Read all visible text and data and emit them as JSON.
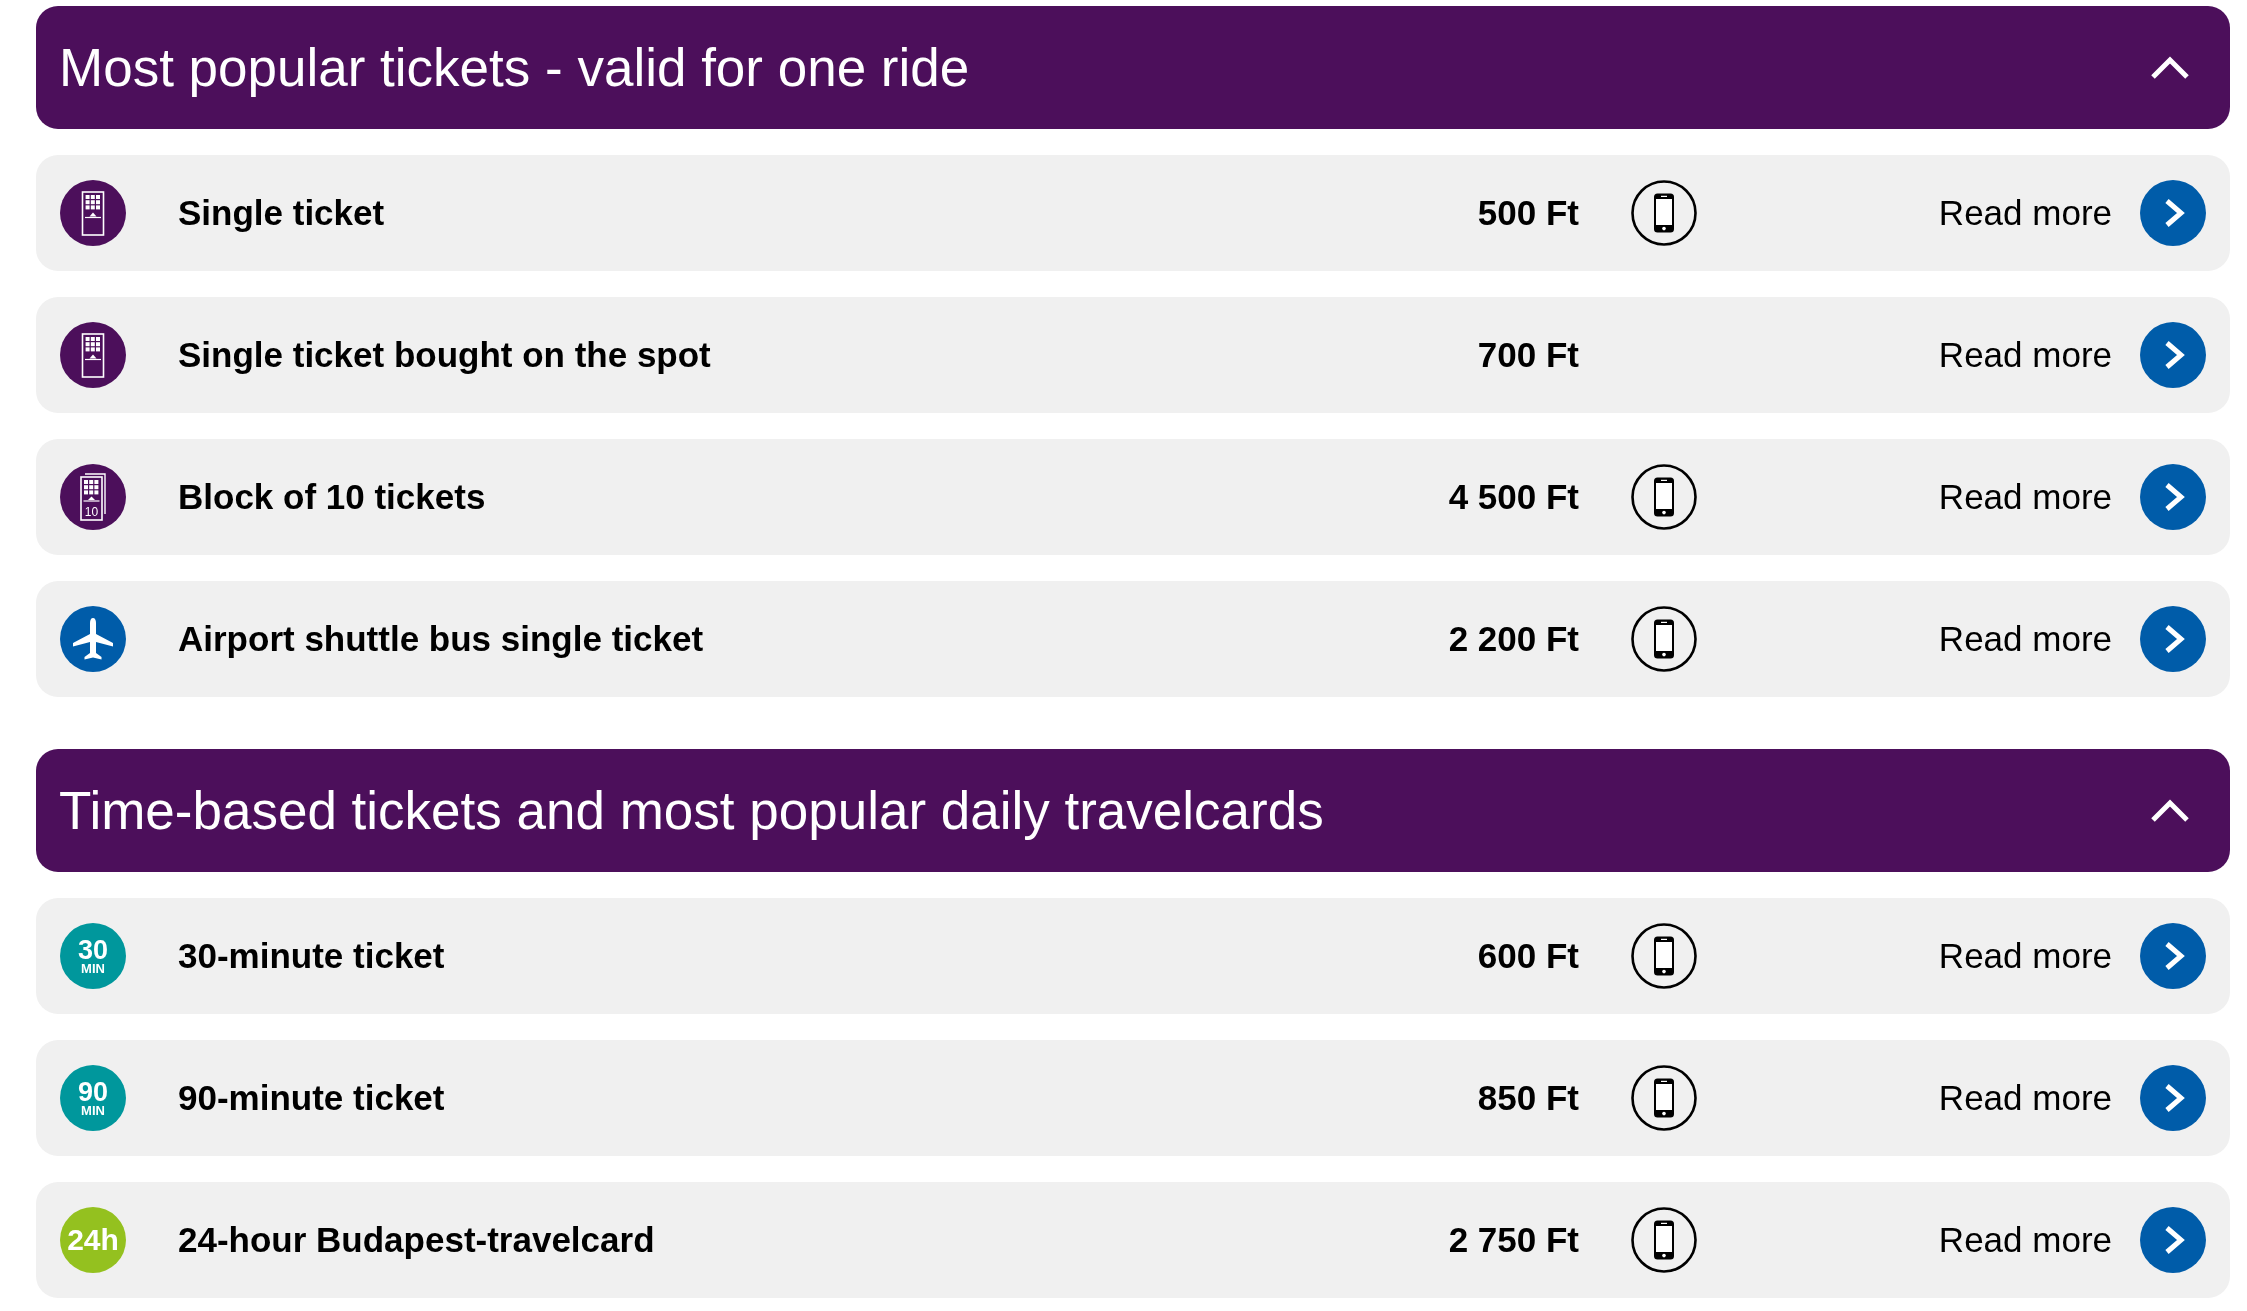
{
  "sections": [
    {
      "title": "Most popular tickets - valid for one ride",
      "expanded": true,
      "rows": [
        {
          "name": "Single ticket",
          "price": "500 Ft",
          "mobile": true,
          "link": "Read more",
          "icon": {
            "kind": "ticket",
            "color": "#4c0f5b"
          }
        },
        {
          "name": "Single ticket bought on the spot",
          "price": "700 Ft",
          "mobile": false,
          "link": "Read more",
          "icon": {
            "kind": "ticket",
            "color": "#4c0f5b"
          }
        },
        {
          "name": "Block of 10 tickets",
          "price": "4 500 Ft",
          "mobile": true,
          "link": "Read more",
          "icon": {
            "kind": "ticket-block",
            "color": "#4c0f5b",
            "text": "10"
          }
        },
        {
          "name": "Airport shuttle bus single ticket",
          "price": "2 200 Ft",
          "mobile": true,
          "link": "Read more",
          "icon": {
            "kind": "plane",
            "color": "#005ca9"
          }
        }
      ]
    },
    {
      "title": "Time-based tickets and most popular daily travelcards",
      "expanded": true,
      "rows": [
        {
          "name": "30-minute ticket",
          "price": "600 Ft",
          "mobile": true,
          "link": "Read more",
          "icon": {
            "kind": "badge",
            "color": "#00979c",
            "lines": [
              "30",
              "MIN"
            ]
          }
        },
        {
          "name": "90-minute ticket",
          "price": "850 Ft",
          "mobile": true,
          "link": "Read more",
          "icon": {
            "kind": "badge",
            "color": "#00979c",
            "lines": [
              "90",
              "MIN"
            ]
          }
        },
        {
          "name": "24-hour Budapest-travelcard",
          "price": "2 750 Ft",
          "mobile": true,
          "link": "Read more",
          "icon": {
            "kind": "badge",
            "color": "#94c11f",
            "lines": [
              "24h"
            ]
          }
        }
      ]
    }
  ]
}
